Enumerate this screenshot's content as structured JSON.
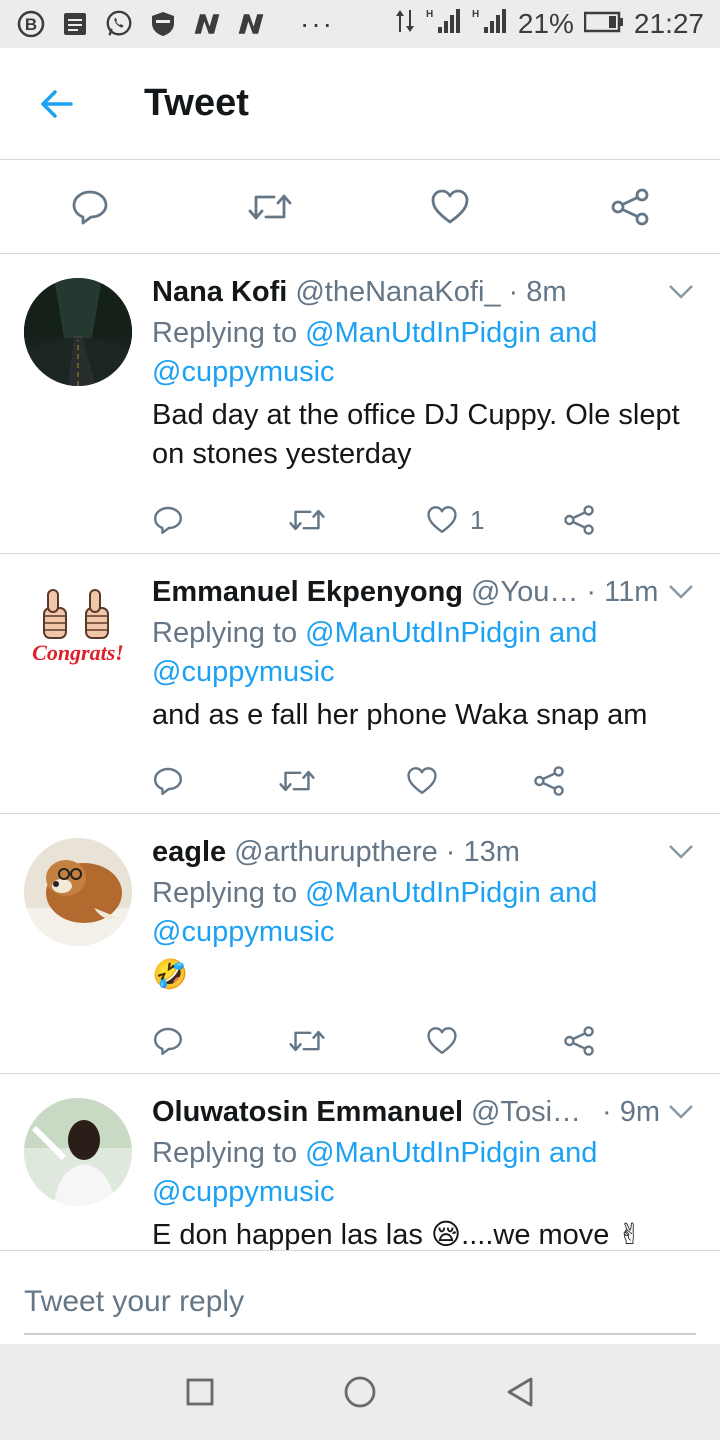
{
  "status_bar": {
    "battery": "21%",
    "time": "21:27",
    "dots": "···",
    "icons": [
      "b-icon",
      "message-icon",
      "whatsapp-icon",
      "shield-icon",
      "n-icon",
      "n-icon",
      "data-arrows-icon",
      "signal-icon",
      "signal-icon",
      "battery-icon"
    ]
  },
  "header": {
    "title": "Tweet",
    "back_icon": "arrow-left-icon"
  },
  "main_actions": [
    "reply-icon",
    "retweet-icon",
    "like-icon",
    "share-icon"
  ],
  "replies": [
    {
      "name": "Nana Kofi",
      "handle": "@theNanaKofi_",
      "time": "· 8m",
      "replying_prefix": "Replying to",
      "replying_link": "@ManUtdInPidgin and @cuppymusic",
      "text": "Bad day at the office DJ Cuppy. Ole slept on stones yesterday",
      "like_count": "1"
    },
    {
      "name": "Emmanuel Ekpenyong",
      "handle": "@You…",
      "time": "· 11m",
      "replying_prefix": "Replying to",
      "replying_link": "@ManUtdInPidgin and @cuppymusic",
      "text": "and as e fall her phone Waka snap am",
      "avatar_text": "Congrats!",
      "like_count": ""
    },
    {
      "name": "eagle",
      "handle": "@arthurupthere",
      "time": "· 13m",
      "replying_prefix": "Replying to",
      "replying_link": "@ManUtdInPidgin and @cuppymusic",
      "text": "🤣",
      "like_count": ""
    },
    {
      "name": "Oluwatosin Emmanuel",
      "handle": "@Tosin…",
      "time": "· 9m",
      "replying_prefix": "Replying to",
      "replying_link": "@ManUtdInPidgin and @cuppymusic",
      "text": "E don happen las las 😪....we move ✌",
      "like_count": ""
    }
  ],
  "reply_box": {
    "placeholder": "Tweet your reply"
  },
  "nav": [
    "recents-square-icon",
    "home-circle-icon",
    "back-triangle-icon"
  ],
  "colors": {
    "accent": "#1da1f2",
    "secondary_text": "#657786",
    "divider": "#d6d9db"
  }
}
